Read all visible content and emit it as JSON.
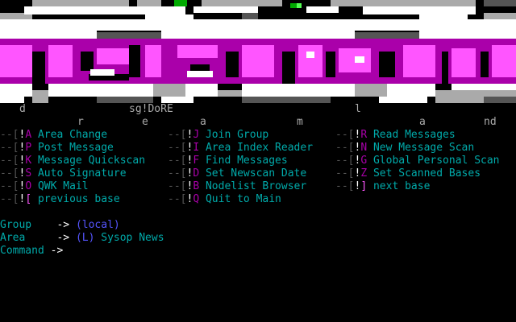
{
  "banner": {
    "signature": "sg!DoRE",
    "letters": [
      "d",
      "r",
      "e",
      "a",
      "m",
      "l",
      "a",
      "nd"
    ],
    "colors": {
      "white": "#ffffff",
      "grey": "#aaaaaa",
      "dark_grey": "#555555",
      "magenta": "#aa00aa",
      "bright_magenta": "#ff55ff",
      "green": "#00aa00"
    }
  },
  "menu": {
    "columns": [
      [
        {
          "prefix": "--[",
          "bang": "!",
          "key": "A",
          "label": "Area Change"
        },
        {
          "prefix": "--[",
          "bang": "!",
          "key": "P",
          "label": "Post Message"
        },
        {
          "prefix": "--[",
          "bang": "!",
          "key": "K",
          "label": "Message Quickscan"
        },
        {
          "prefix": "--[",
          "bang": "!",
          "key": "S",
          "label": "Auto Signature"
        },
        {
          "prefix": "--[",
          "bang": "!",
          "key": "O",
          "label": "QWK Mail"
        },
        {
          "prefix": "--[",
          "bang": "!",
          "key": "[",
          "label": "previous base"
        }
      ],
      [
        {
          "prefix": "--[",
          "bang": "!",
          "key": "J",
          "label": "Join Group"
        },
        {
          "prefix": "--[",
          "bang": "!",
          "key": "I",
          "label": "Area Index Reader"
        },
        {
          "prefix": "--[",
          "bang": "!",
          "key": "F",
          "label": "Find Messages"
        },
        {
          "prefix": "--[",
          "bang": "!",
          "key": "D",
          "label": "Set Newscan Date"
        },
        {
          "prefix": "--[",
          "bang": "!",
          "key": "B",
          "label": "Nodelist Browser"
        },
        {
          "prefix": "--[",
          "bang": "!",
          "key": "Q",
          "label": "Quit to Main"
        }
      ],
      [
        {
          "prefix": "--[",
          "bang": "!",
          "key": "R",
          "label": "Read Messages"
        },
        {
          "prefix": "--[",
          "bang": "!",
          "key": "N",
          "label": "New Message Scan"
        },
        {
          "prefix": "--[",
          "bang": "!",
          "key": "G",
          "label": "Global Personal Scan"
        },
        {
          "prefix": "--[",
          "bang": "!",
          "key": "Z",
          "label": "Set Scanned Bases"
        },
        {
          "prefix": "--[",
          "bang": "!",
          "key": "]",
          "label": "next base"
        }
      ]
    ]
  },
  "status": {
    "group_label": "Group",
    "group_arrow": "->",
    "group_value": "(local)",
    "area_label": "Area",
    "area_arrow": "->",
    "area_code": "(L)",
    "area_value": "Sysop News",
    "command_label": "Command",
    "command_arrow": "->"
  }
}
